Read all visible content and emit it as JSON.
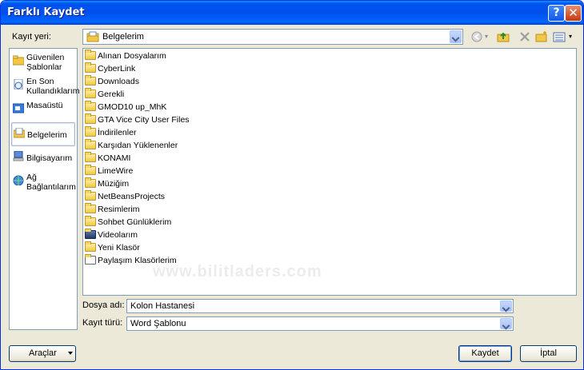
{
  "window": {
    "title": "Farklı Kaydet",
    "help_glyph": "?",
    "close_glyph": "✕"
  },
  "location": {
    "label": "Kayıt yeri:",
    "current": "Belgelerim"
  },
  "places": [
    {
      "label": "Güvenilen Şablonlar",
      "icon": "trusted-templates-icon"
    },
    {
      "label": "En Son Kullandıklarım",
      "icon": "recent-documents-icon"
    },
    {
      "label": "Masaüstü",
      "icon": "desktop-icon"
    },
    {
      "label": "Belgelerim",
      "icon": "my-documents-icon",
      "selected": true
    },
    {
      "label": "Bilgisayarım",
      "icon": "my-computer-icon"
    },
    {
      "label": "Ağ Bağlantılarım",
      "icon": "network-places-icon"
    }
  ],
  "files": [
    "Alınan Dosyalarım",
    "CyberLink",
    "Downloads",
    "Gerekli",
    "GMOD10 up_MhK",
    "GTA Vice City User Files",
    "İndirilenler",
    "Karşıdan Yüklenenler",
    "KONAMI",
    "LimeWire",
    "Müziğim",
    "NetBeansProjects",
    "Resimlerim",
    "Sohbet Günlüklerim",
    "Videolarım",
    "Yeni Klasör",
    "Paylaşım Klasörlerim"
  ],
  "watermark": "www.bilitladers.com",
  "filename": {
    "label": "Dosya adı:",
    "value": "Kolon Hastanesi"
  },
  "filetype": {
    "label": "Kayıt türü:",
    "value": "Word Şablonu"
  },
  "buttons": {
    "tools": "Araçlar",
    "save": "Kaydet",
    "cancel": "İptal"
  }
}
